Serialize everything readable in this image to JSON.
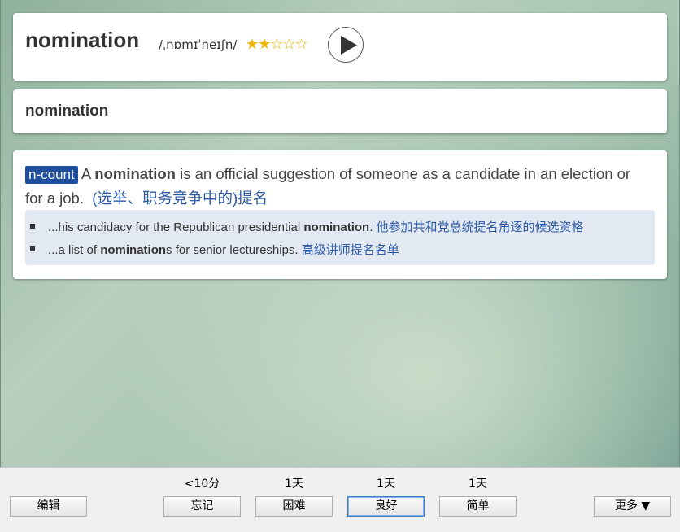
{
  "header": {
    "word": "nomination",
    "phonetic": "/ˌnɒmɪˈneɪʃn/",
    "stars": "★★☆☆☆",
    "star_rating": 2,
    "star_max": 5
  },
  "headword2": "nomination",
  "definition": {
    "tag": "n-count",
    "pre": " A ",
    "bold": "nomination",
    "post": " is an official suggestion of someone as a candidate in an election or for a job.",
    "zh": "(选举、职务竞争中的)提名"
  },
  "examples": [
    {
      "pre": "...his candidacy for the Republican presidential ",
      "bold": "nomination",
      "post": ".",
      "zh": "他参加共和党总统提名角逐的候选资格"
    },
    {
      "pre": "...a list of ",
      "bold": "nomination",
      "post": "s for senior lectureships.",
      "zh": "高级讲师提名名单"
    }
  ],
  "bottom": {
    "edit_label": "编辑",
    "more_label": "更多 ▼",
    "answers": [
      {
        "interval": "<10分",
        "label": "忘记"
      },
      {
        "interval": "1天",
        "label": "困难"
      },
      {
        "interval": "1天",
        "label": "良好"
      },
      {
        "interval": "1天",
        "label": "简单"
      }
    ]
  },
  "colors": {
    "tag_bg": "#1f4f9e",
    "chinese_text": "#2a58a8",
    "star": "#f0b400"
  },
  "icons": {
    "play": "play-icon",
    "bullet": "bullet-icon"
  }
}
